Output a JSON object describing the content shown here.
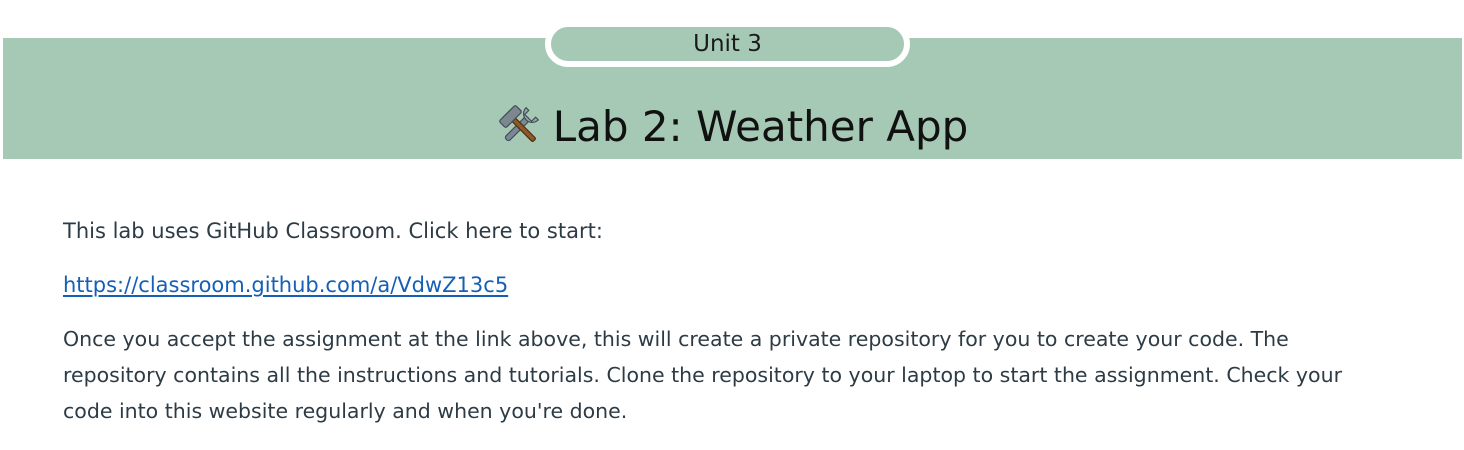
{
  "header": {
    "unit_label": "Unit 3",
    "title": "Lab 2: Weather App",
    "title_icon": "hammer-and-wrench-icon",
    "banner_color": "#a5c9b4"
  },
  "content": {
    "intro": "This lab uses GitHub Classroom. Click here to start:",
    "link": {
      "text": "https://classroom.github.com/a/VdwZ13c5",
      "href": "https://classroom.github.com/a/VdwZ13c5",
      "color": "#1560b6"
    },
    "description": "Once you accept the assignment at the link above, this will create a private repository for you to create your code. The repository contains all the instructions and tutorials. Clone the repository to your laptop to start the assignment. Check your code into this website regularly and when you're done."
  }
}
